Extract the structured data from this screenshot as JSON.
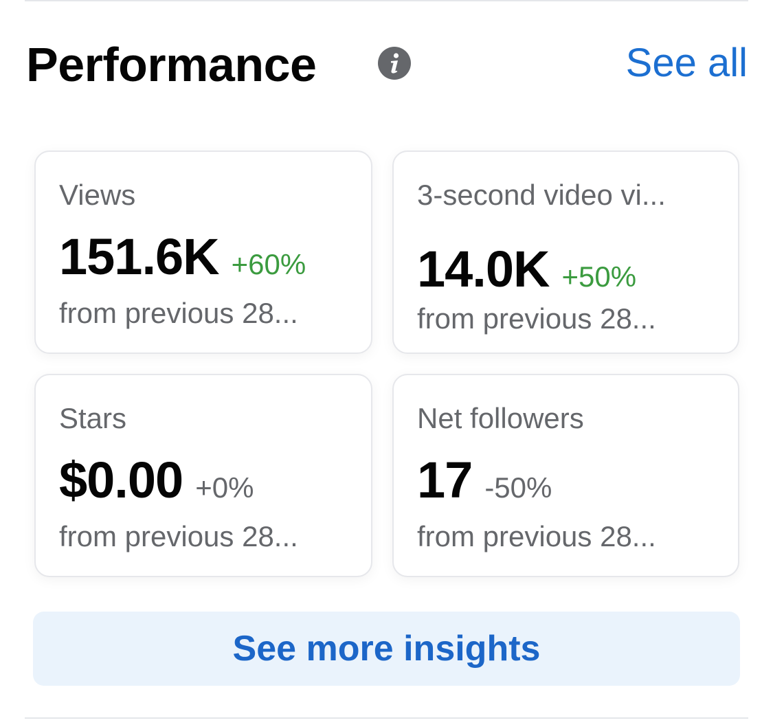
{
  "header": {
    "title": "Performance",
    "info_icon": "info-icon",
    "see_all_label": "See all"
  },
  "cards": [
    {
      "label": "Views",
      "value": "151.6K",
      "change": "+60%",
      "change_color": "#3b9b3f",
      "subtext": "from previous 28..."
    },
    {
      "label": "3-second video vi...",
      "value": "14.0K",
      "change": "+50%",
      "change_color": "#3b9b3f",
      "subtext": "from previous 28..."
    },
    {
      "label": "Stars",
      "value": "$0.00",
      "change": "+0%",
      "change_color": "#65676b",
      "subtext": "from previous 28..."
    },
    {
      "label": "Net followers",
      "value": "17",
      "change": "-50%",
      "change_color": "#65676b",
      "subtext": "from previous 28..."
    }
  ],
  "insights_button": {
    "label": "See more insights"
  },
  "colors": {
    "accent": "#1c6fd1",
    "positive": "#3b9b3f",
    "muted": "#65676b",
    "button_bg": "#eaf3fc"
  }
}
